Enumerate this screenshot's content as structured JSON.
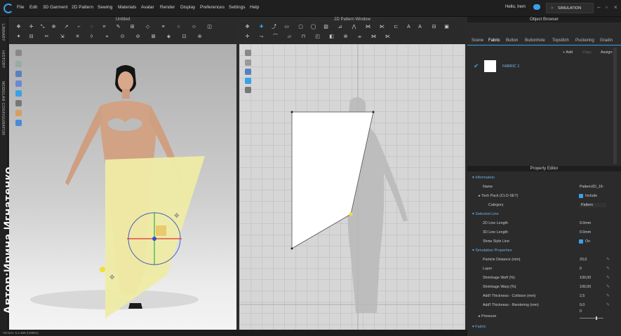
{
  "menu": [
    "File",
    "Edit",
    "3D Garment",
    "2D Pattern",
    "Sewing",
    "Materials",
    "Avatar",
    "Render",
    "Display",
    "Preferences",
    "Settings",
    "Help"
  ],
  "user": "Hello, Irem",
  "simulation_label": "SIMULATION",
  "side_tabs": [
    "LIBRARY",
    "HISTORY",
    "MODULAR CONFIGURATOR"
  ],
  "watermark": "Автор:Ирина Игнатенко",
  "pane_3d_title": "Untitled",
  "pane_2d_title": "2D Pattern Window",
  "object_browser": {
    "title": "Object Browser",
    "tabs": [
      "Scene",
      "Fabric",
      "Button",
      "Buttonhole",
      "Topstitch",
      "Puckering",
      "Gradin"
    ],
    "active_tab": "Fabric",
    "add": "+ Add",
    "copy": "Copy",
    "assign": "Assign",
    "fabric_name": "FABRIC 1"
  },
  "property_editor": {
    "title": "Property Editor",
    "sections": {
      "information": "Information",
      "selected_line": "Selected Line",
      "simulation": "Simulation Properties",
      "fabric": "Fabric"
    },
    "rows": {
      "name": {
        "label": "Name",
        "value": "Pattern2D_16-"
      },
      "tech_pack": {
        "label": "Tech Pack (CLO-SET)",
        "value": "Include"
      },
      "category": {
        "label": "Category",
        "value": "Pattern"
      },
      "line2d": {
        "label": "2D Line Length",
        "value": "0.0mm"
      },
      "line3d": {
        "label": "3D Line Length",
        "value": "0.0mm"
      },
      "style_line": {
        "label": "Show Style Line",
        "value": "On"
      },
      "particle": {
        "label": "Particle Distance (mm)",
        "value": "20,0"
      },
      "layer": {
        "label": "Layer",
        "value": "0"
      },
      "weft": {
        "label": "Shrinkage Weft (%)",
        "value": "100,00"
      },
      "warp": {
        "label": "Shrinkage Warp (%)",
        "value": "100,00"
      },
      "collision": {
        "label": "Add'l Thickness - Collision (mm)",
        "value": "2,5"
      },
      "rendering": {
        "label": "Add'l Thickness - Rendering (mm)",
        "value": "0,0"
      },
      "pressure": {
        "label": "Pressure",
        "value": "0"
      }
    }
  },
  "status": "Version: 5.2.368 (r29961)",
  "colors": {
    "accent": "#3aa0e8",
    "pattern_3d": "#eeeba6",
    "selection": "#f0e030"
  }
}
